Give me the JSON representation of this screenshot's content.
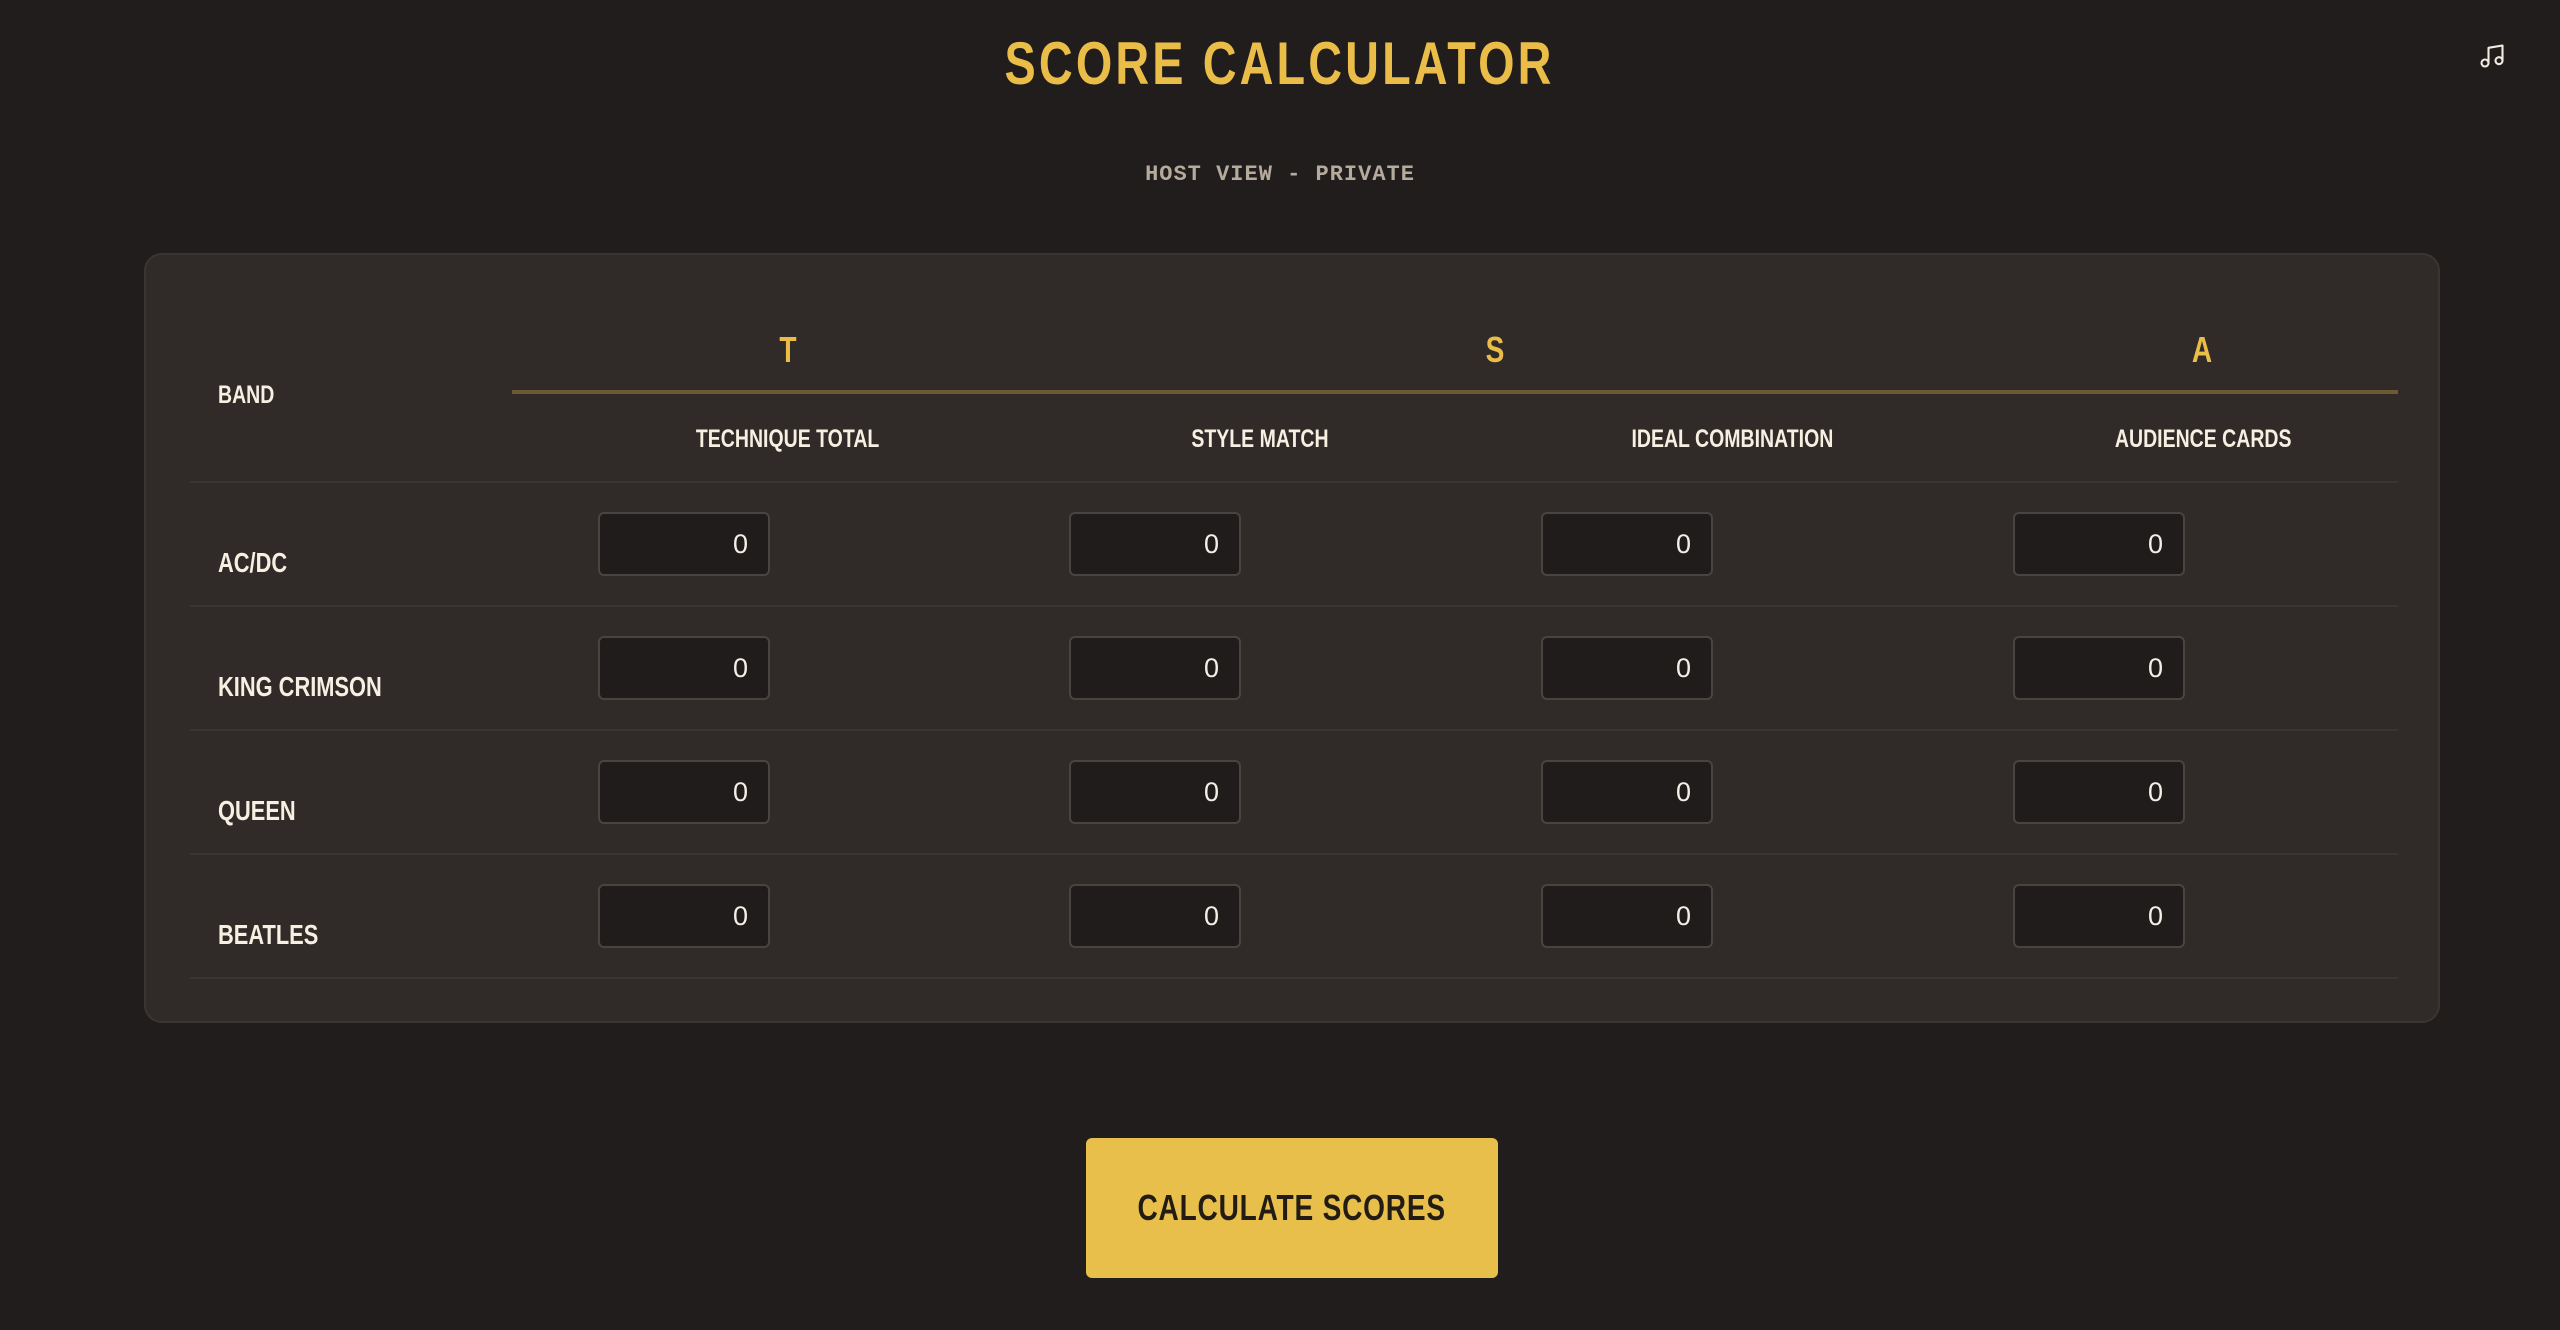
{
  "header": {
    "title": "SCORE CALCULATOR",
    "subtitle": "HOST VIEW - PRIVATE",
    "music_icon": "music-note-icon"
  },
  "table": {
    "band_header": "BAND",
    "groups": [
      {
        "letter": "T"
      },
      {
        "letter": "S"
      },
      {
        "letter": "A"
      }
    ],
    "columns": [
      {
        "label": "TECHNIQUE TOTAL"
      },
      {
        "label": "STYLE MATCH"
      },
      {
        "label": "IDEAL COMBINATION"
      },
      {
        "label": "AUDIENCE CARDS"
      }
    ],
    "rows": [
      {
        "band": "AC/DC",
        "values": [
          "0",
          "0",
          "0",
          "0"
        ]
      },
      {
        "band": "KING CRIMSON",
        "values": [
          "0",
          "0",
          "0",
          "0"
        ]
      },
      {
        "band": "QUEEN",
        "values": [
          "0",
          "0",
          "0",
          "0"
        ]
      },
      {
        "band": "BEATLES",
        "values": [
          "0",
          "0",
          "0",
          "0"
        ]
      }
    ]
  },
  "actions": {
    "calculate_label": "CALCULATE SCORES"
  },
  "colors": {
    "background": "#201d1c",
    "panel": "#302b28",
    "accent": "#e9bd48"
  }
}
